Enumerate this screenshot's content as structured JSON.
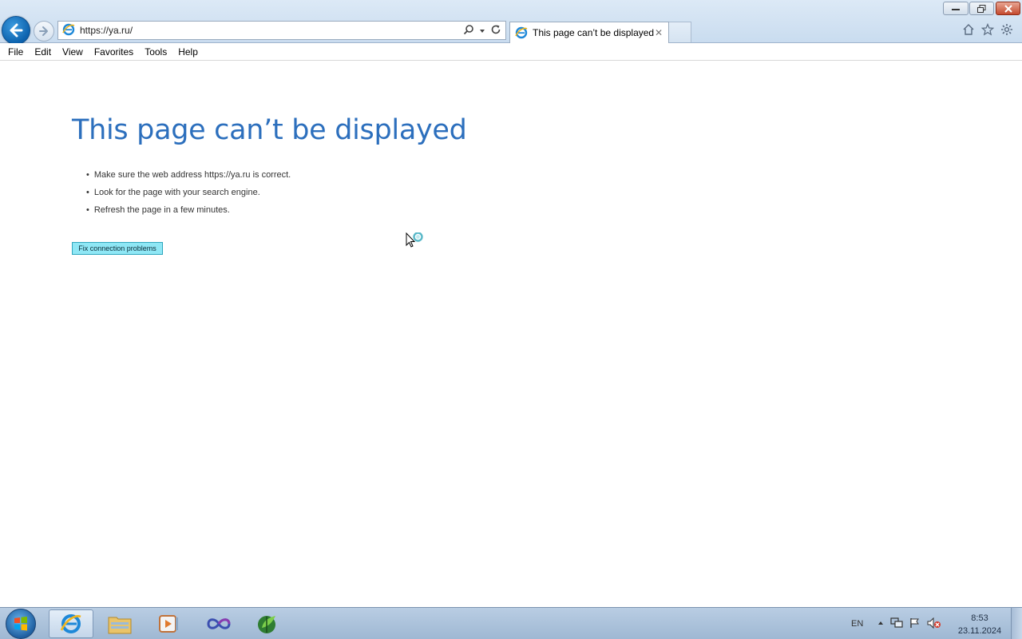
{
  "browser": {
    "url": "https://ya.ru/",
    "tab_title": "This page can’t be displayed",
    "tab_close": "✕",
    "window_controls": {
      "minimize": "–",
      "maximize": "❐",
      "close": "✕"
    },
    "nav_icons": [
      "back-arrow-icon",
      "forward-arrow-icon",
      "search-icon",
      "refresh-icon",
      "home-icon",
      "favorites-star-icon",
      "settings-gear-icon"
    ]
  },
  "menu": {
    "items": [
      {
        "label": "File"
      },
      {
        "label": "Edit"
      },
      {
        "label": "View"
      },
      {
        "label": "Favorites"
      },
      {
        "label": "Tools"
      },
      {
        "label": "Help"
      }
    ]
  },
  "page": {
    "title": "This page can’t be displayed",
    "tips": [
      "Make sure the web address https://ya.ru is correct.",
      "Look for the page with your search engine.",
      "Refresh the page in a few minutes."
    ],
    "fix_button": "Fix connection problems"
  },
  "taskbar": {
    "apps": [
      "internet-explorer",
      "file-explorer",
      "media-player",
      "infinity-app",
      "green-leaf-app"
    ],
    "language": "EN",
    "time": "8:53",
    "date": "23.11.2024"
  },
  "colors": {
    "title_blue": "#2c6fbd",
    "fix_button_bg": "#8fe7f5",
    "taskbar": "#a8c0da"
  }
}
